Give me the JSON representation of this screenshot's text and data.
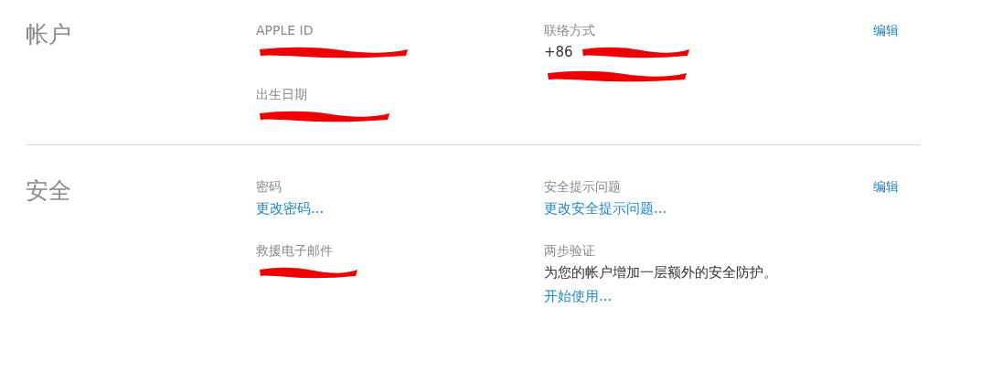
{
  "sections": [
    {
      "title": "帐户",
      "columns": [
        [
          {
            "label": "APPLE ID",
            "lines": [
              [
                {
                  "kind": "scribble"
                }
              ]
            ]
          },
          {
            "label": "出生日期",
            "lines": [
              [
                {
                  "kind": "scribble"
                }
              ]
            ]
          }
        ],
        [
          {
            "label": "联络方式",
            "lines": [
              [
                {
                  "kind": "text",
                  "text": "+86"
                },
                {
                  "kind": "scribble"
                }
              ],
              [
                {
                  "kind": "scribble"
                }
              ]
            ]
          }
        ]
      ],
      "edit": "编辑"
    },
    {
      "title": "安全",
      "columns": [
        [
          {
            "label": "密码",
            "lines": [
              [
                {
                  "kind": "link",
                  "text": "更改密码..."
                }
              ]
            ]
          },
          {
            "label": "救援电子邮件",
            "lines": [
              [
                {
                  "kind": "scribble"
                }
              ]
            ]
          }
        ],
        [
          {
            "label": "安全提示问题",
            "lines": [
              [
                {
                  "kind": "link",
                  "text": "更改安全提示问题..."
                }
              ]
            ]
          },
          {
            "label": "两步验证",
            "lines": [
              [
                {
                  "kind": "text",
                  "text": "为您的帐户增加一层额外的安全防护。"
                }
              ],
              [
                {
                  "kind": "link",
                  "text": "开始使用..."
                }
              ]
            ]
          }
        ]
      ],
      "edit": "编辑"
    }
  ]
}
